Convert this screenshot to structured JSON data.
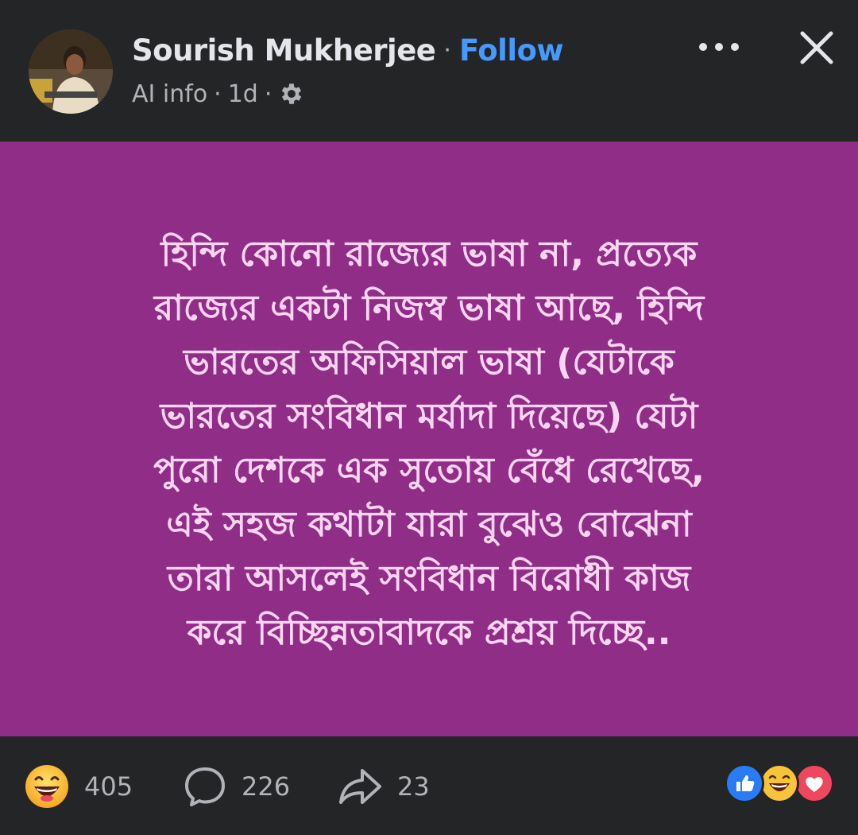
{
  "header": {
    "author_name": "Sourish Mukherjee",
    "separator": "·",
    "follow_label": "Follow",
    "ai_info_label": "AI info",
    "meta_separator": "·",
    "timestamp": "1d",
    "privacy_icon": "gear-icon",
    "more_icon": "more-dots-icon",
    "close_icon": "close-icon"
  },
  "post": {
    "background_color": "#902d86",
    "text_color": "#ffd6f2",
    "lines": [
      "হিন্দি কোনো রাজ্যের ভাষা না, প্রত্যেক",
      "রাজ্যের একটা নিজস্ব ভাষা আছে, হিন্দি",
      "ভারতের অফিসিয়াল ভাষা (যেটাকে",
      "ভারতের সংবিধান মর্যাদা দিয়েছে) যেটা",
      "পুরো দেশকে এক সুতোয় বেঁধে রেখেছে,",
      "এই সহজ কথাটা যারা বুঝেও বোঝেনা",
      "তারা আসলেই সংবিধান বিরোধী কাজ",
      "করে বিচ্ছিন্নতাবাদকে প্রশ্রয় দিচ্ছে.."
    ]
  },
  "footer": {
    "reaction_icon": "laughing-emoji-icon",
    "reaction_count": "405",
    "comment_icon": "comment-bubble-icon",
    "comment_count": "226",
    "share_icon": "share-arrow-icon",
    "share_count": "23",
    "reaction_summary_icons": [
      "like-icon",
      "haha-icon",
      "love-icon"
    ]
  },
  "colors": {
    "background": "#242526",
    "accent": "#4599ff",
    "muted_text": "#b0b3b8",
    "primary_text": "#e4e6eb"
  }
}
